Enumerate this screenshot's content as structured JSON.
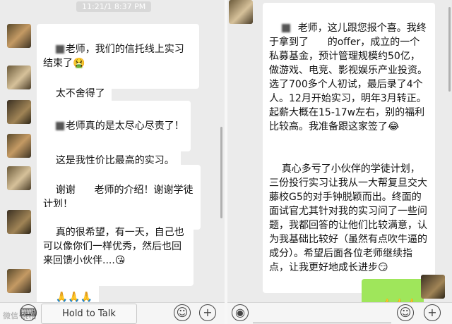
{
  "left": {
    "timestamp": "11:21/1 8:37 PM",
    "messages": [
      {
        "text": "老师，我们的信托线上实习结束了🤮"
      },
      {
        "text": "太不舍得了"
      },
      {
        "text": "老师真的是太尽心尽责了！"
      },
      {
        "text": "这是我性价比最高的实习。"
      },
      {
        "text": "谢谢      老师的介绍！谢谢学徒计划！"
      },
      {
        "text": "真的很希望，有一天，自己也可以像你们一样优秀，然后也回来回馈小伙伴....😘"
      },
      {
        "text": "🙏🙏🙏"
      }
    ],
    "input_bar": {
      "hold_to_talk": "Hold to Talk",
      "watermark": "微信·跳槽"
    }
  },
  "right": {
    "messages": [
      {
        "text": "  老师，这儿跟您报个喜。我终于拿到了      的offer，成立的一个私募基金，预计管理规模约50亿，做游戏、电竞、影视娱乐产业投资。选了700多个人初试，最后录了4个人。12月开始实习，明年3月转正。起薪大概在15-17w左右，别的福利比较高。我准备跟这家签了😂"
      },
      {
        "text": "真心多亏了小伙伴的学徒计划，三份投行实习让我从一大帮复旦交大藤校G5的对手钟脱颖而出。终面的面试官尤其针对我的实习问了一些问题，我都回答的让他们比较满意，认为我基础比较好（虽然有点吹牛逼的成分）。希望后面各位老师继续指点，让我更好地成长进步😏"
      },
      {
        "text": "👍👍👍"
      }
    ]
  }
}
